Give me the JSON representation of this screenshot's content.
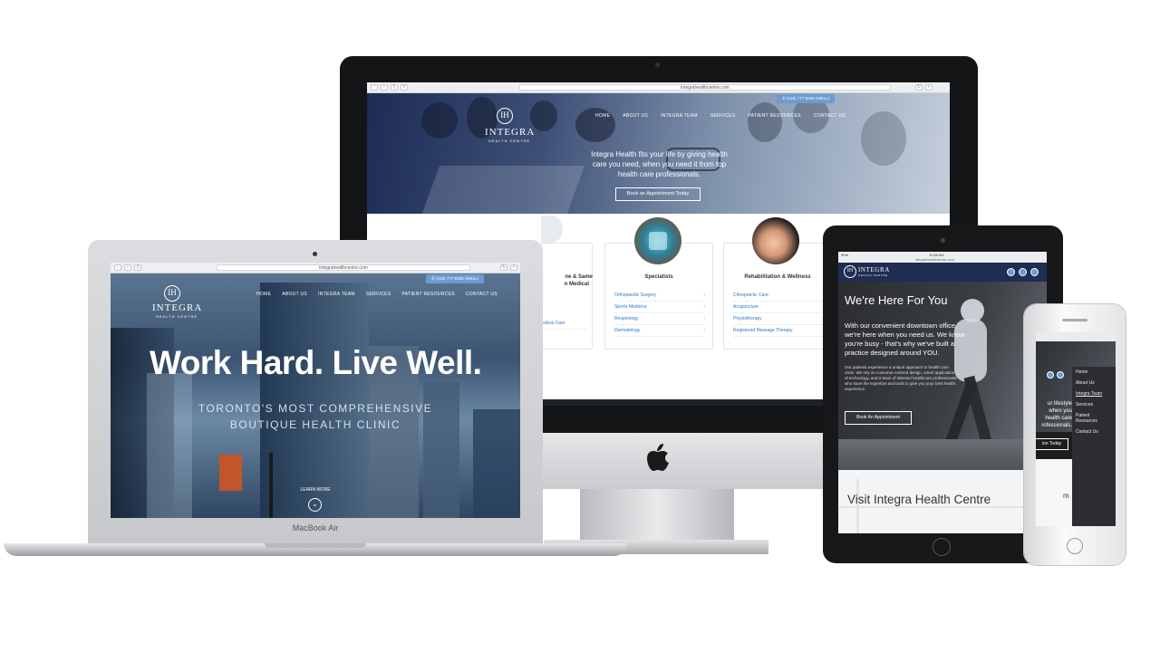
{
  "imac": {
    "url": "integrahealthcentre.com",
    "logo": {
      "name": "INTEGRA",
      "sub": "HEALTH CENTRE",
      "mark": "IH"
    },
    "phone": "(416) 777-9355 (WELL)",
    "nav": [
      "HOME",
      "ABOUT US",
      "INTEGRA TEAM",
      "SERVICES",
      "PATIENT RESOURCES",
      "CONTACT US"
    ],
    "hero_text": "Integra Health fits your life by giving health care you need, when you need it from top health care professionals.",
    "cta": "Book an Appointment Today",
    "services": [
      {
        "title": "ne & Same",
        "title2": "n Medical",
        "links": [
          "",
          "",
          "edical Care",
          ""
        ]
      },
      {
        "title": "Specialists",
        "links": [
          "Orthopaedic Surgery",
          "Sports Medicine",
          "Respirology",
          "Dermatology"
        ]
      },
      {
        "title": "Rehabilitation & Wellness",
        "links": [
          "Chiropractic Care",
          "Acupuncture",
          "Physiotherapy",
          "Registered Massage Therapy"
        ]
      }
    ]
  },
  "macbook": {
    "url": "integrahealthcentre.com",
    "label": "MacBook Air",
    "logo": {
      "name": "INTEGRA",
      "sub": "HEALTH CENTRE",
      "mark": "IH"
    },
    "phone": "(416) 777-9355 (WELL)",
    "nav": [
      "HOME",
      "ABOUT US",
      "INTEGRA TEAM",
      "SERVICES",
      "PATIENT RESOURCES",
      "CONTACT US"
    ],
    "headline": "Work Hard. Live Well.",
    "subline1": "TORONTO'S MOST COMPREHENSIVE",
    "subline2": "BOUTIQUE HEALTH CLINIC",
    "learn_more": "LEARN MORE",
    "chevron_icon": "chevron-down"
  },
  "ipad": {
    "status_left": "iPad",
    "status_center": "11:58 AM",
    "url": "integrahealthcentre.com",
    "logo": {
      "name": "INTEGRA",
      "sub": "HEALTH CENTRE"
    },
    "headline": "We're Here For You",
    "paragraph": "With our convenient downtown office, we're here when you need us. We know you're busy - that's why we've built a practice designed around YOU.",
    "paragraph2": "Our patients experience a unique approach to health care visits. We rely on customer-centred design, smart application of technology, and a team of talented healthcare professionals who have the expertise and tools to give you your best health experience.",
    "cta": "Book An Appointment",
    "visit": "Visit Integra Health Centre"
  },
  "iphone": {
    "menu": [
      "Home",
      "About Us",
      "Integra Team",
      "Services",
      "Patient Resources",
      "Contact Us"
    ],
    "partial_text": [
      "ur lifestyle",
      "when you",
      "health care",
      "rofessionals."
    ],
    "cta": "ion Today",
    "fragment": "m"
  },
  "colors": {
    "accent": "#2b7bc1",
    "pill": "#6c9bd1",
    "hero_navy": "#1c2c55"
  }
}
